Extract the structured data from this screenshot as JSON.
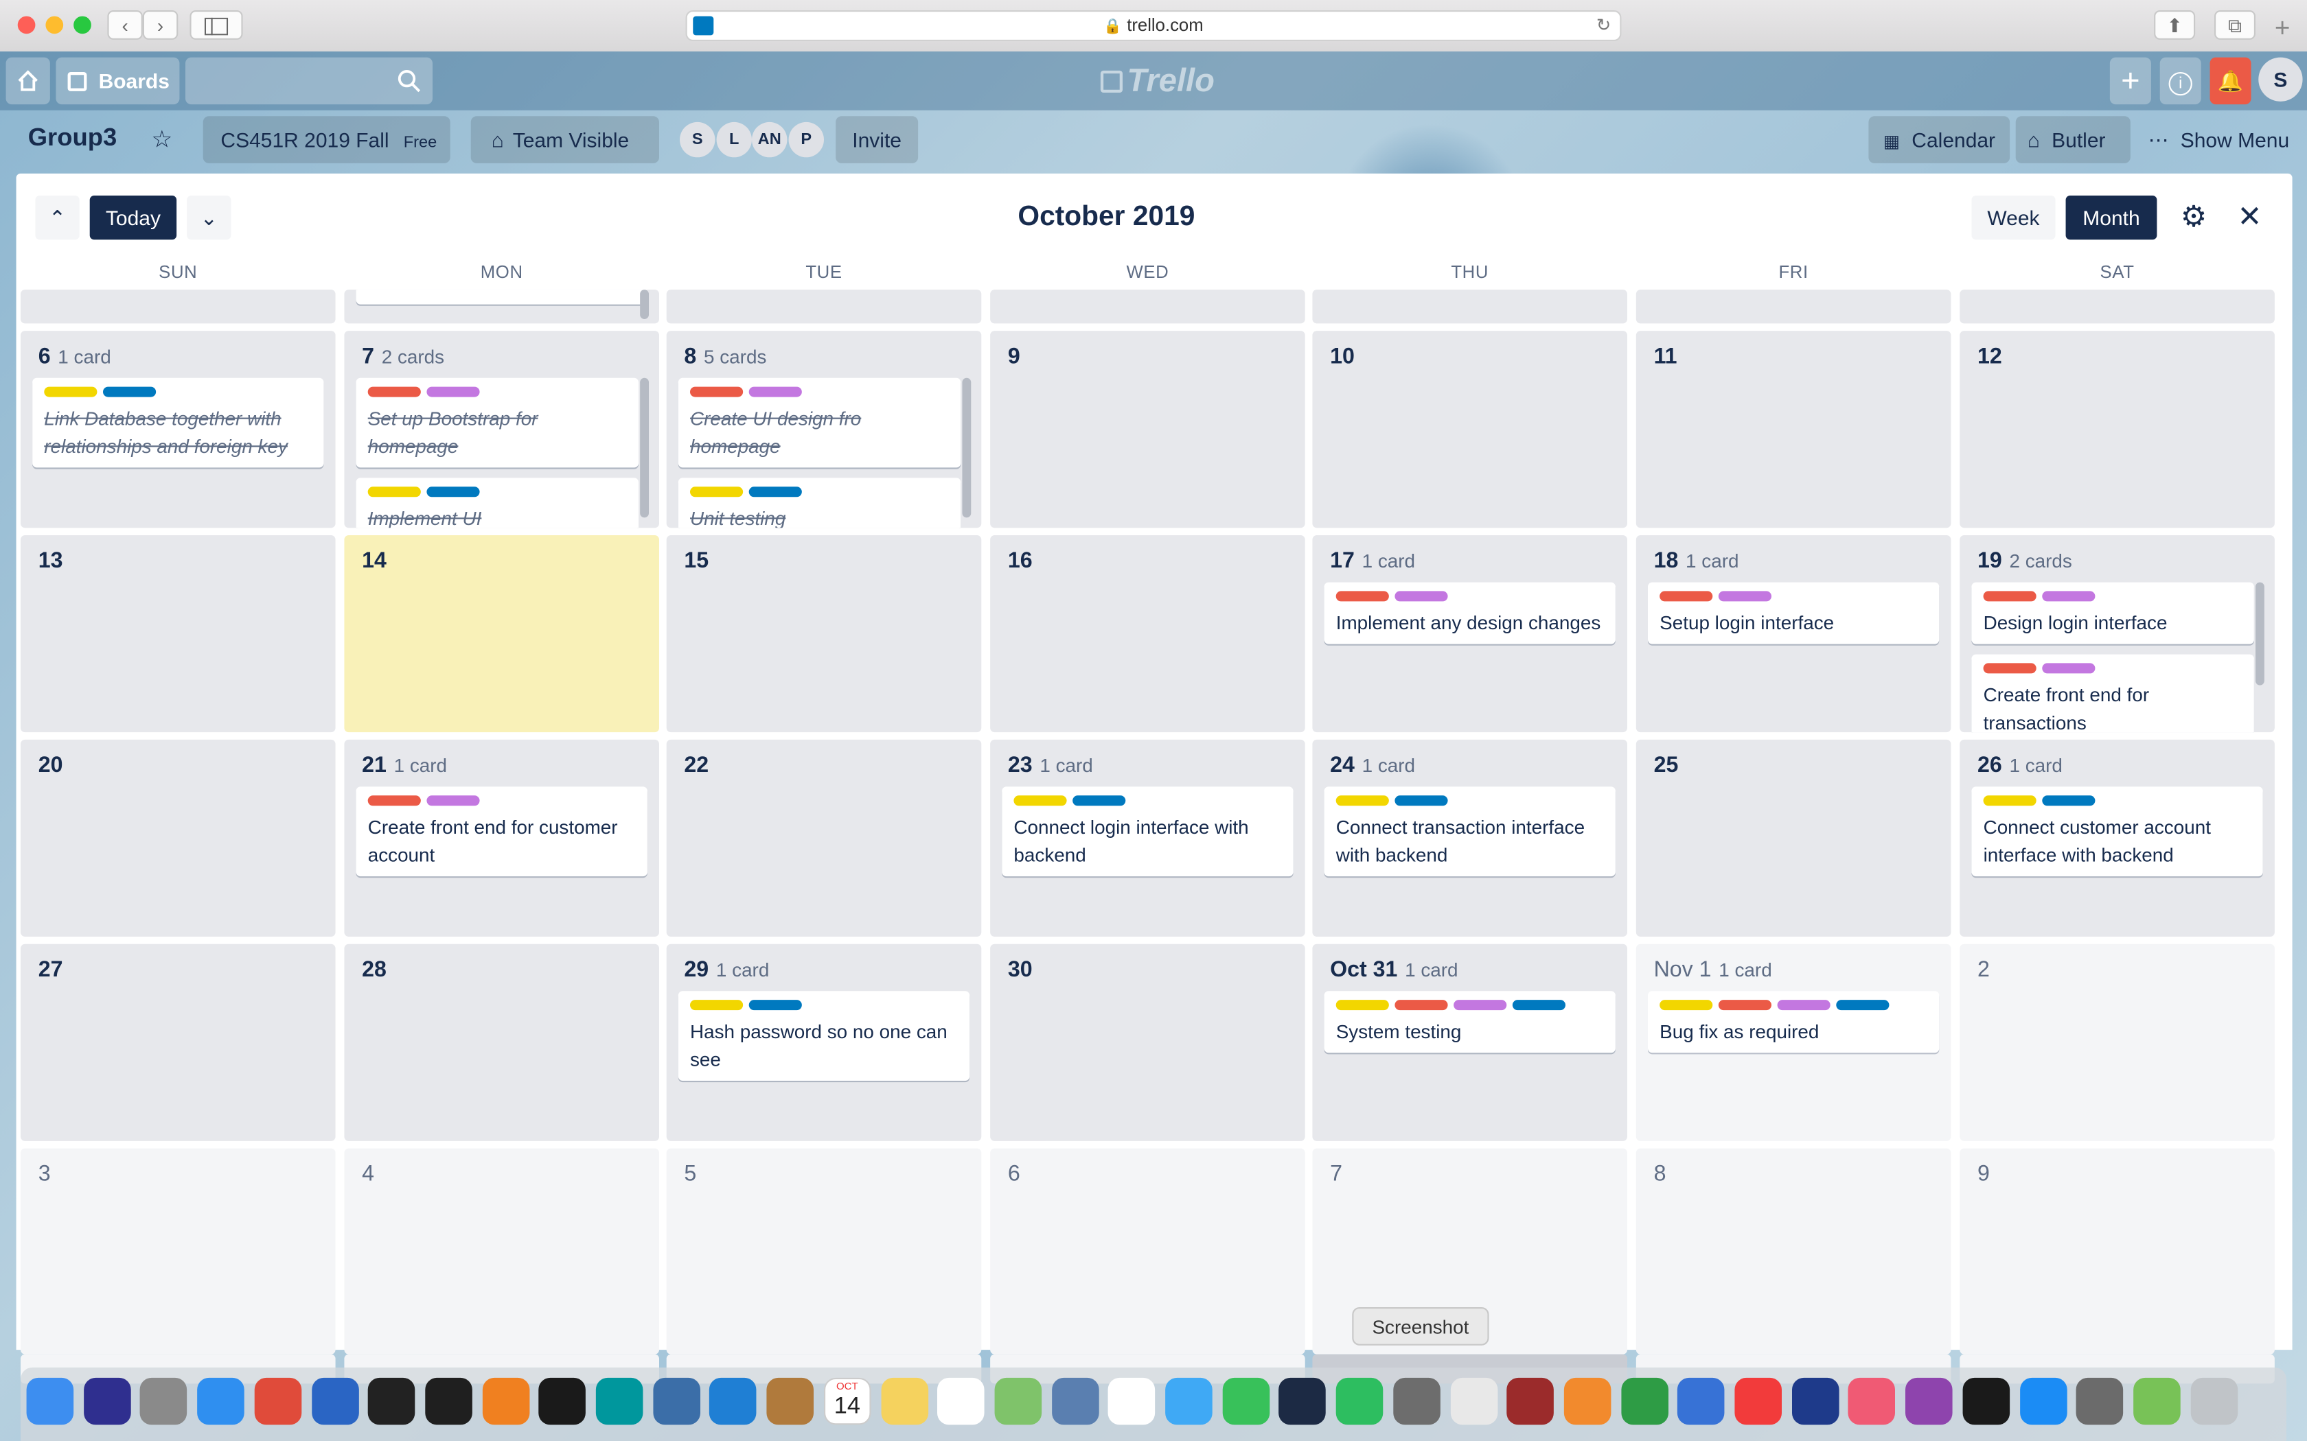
{
  "browser": {
    "url": "trello.com",
    "dock_tooltip": "Screenshot"
  },
  "header": {
    "boards_label": "Boards",
    "logo_text": "Trello",
    "user_initial": "S"
  },
  "board": {
    "name": "Group3",
    "team": "CS451R 2019 Fall",
    "team_badge": "Free",
    "visibility": "Team Visible",
    "members": [
      "S",
      "L",
      "AN",
      "P"
    ],
    "invite_label": "Invite",
    "calendar_label": "Calendar",
    "butler_label": "Butler",
    "show_menu_label": "Show Menu"
  },
  "calendar": {
    "title": "October 2019",
    "today_label": "Today",
    "week_label": "Week",
    "month_label": "Month",
    "weekdays": [
      "SUN",
      "MON",
      "TUE",
      "WED",
      "THU",
      "FRI",
      "SAT"
    ]
  },
  "colors": {
    "yellow": "#f2d600",
    "red": "#eb5a46",
    "purple": "#c377e0",
    "blue": "#0079bf",
    "today_bg": "#f9f1b8",
    "nav_dark": "#172b4d"
  },
  "weeks": [
    {
      "days": [
        {
          "num": "6",
          "count": "1 card",
          "cards": [
            {
              "labels": [
                "yellow",
                "blue"
              ],
              "text": "Link Database together with relationships and foreign key",
              "done": true
            }
          ]
        },
        {
          "num": "7",
          "count": "2 cards",
          "cards": [
            {
              "labels": [
                "red",
                "purple"
              ],
              "text": "Set up Bootstrap for homepage",
              "done": true
            },
            {
              "labels": [
                "yellow",
                "blue"
              ],
              "text": "Implement UI",
              "done": true
            }
          ]
        },
        {
          "num": "8",
          "count": "5 cards",
          "cards": [
            {
              "labels": [
                "red",
                "purple"
              ],
              "text": "Create UI design fro homepage",
              "done": true
            },
            {
              "labels": [
                "yellow",
                "blue"
              ],
              "text": "Unit testing",
              "done": true
            }
          ]
        },
        {
          "num": "9",
          "count": "",
          "cards": []
        },
        {
          "num": "10",
          "count": "",
          "cards": []
        },
        {
          "num": "11",
          "count": "",
          "cards": []
        },
        {
          "num": "12",
          "count": "",
          "cards": []
        }
      ]
    },
    {
      "days": [
        {
          "num": "13",
          "count": "",
          "cards": []
        },
        {
          "num": "14",
          "count": "",
          "cards": [],
          "today": true
        },
        {
          "num": "15",
          "count": "",
          "cards": []
        },
        {
          "num": "16",
          "count": "",
          "cards": []
        },
        {
          "num": "17",
          "count": "1 card",
          "cards": [
            {
              "labels": [
                "red",
                "purple"
              ],
              "text": "Implement any design changes"
            }
          ]
        },
        {
          "num": "18",
          "count": "1 card",
          "cards": [
            {
              "labels": [
                "red",
                "purple"
              ],
              "text": "Setup login interface"
            }
          ]
        },
        {
          "num": "19",
          "count": "2 cards",
          "cards": [
            {
              "labels": [
                "red",
                "purple"
              ],
              "text": "Design login interface"
            },
            {
              "labels": [
                "red",
                "purple"
              ],
              "text": "Create front end for transactions"
            }
          ]
        }
      ]
    },
    {
      "days": [
        {
          "num": "20",
          "count": "",
          "cards": []
        },
        {
          "num": "21",
          "count": "1 card",
          "cards": [
            {
              "labels": [
                "red",
                "purple"
              ],
              "text": "Create front end for customer account"
            }
          ]
        },
        {
          "num": "22",
          "count": "",
          "cards": []
        },
        {
          "num": "23",
          "count": "1 card",
          "cards": [
            {
              "labels": [
                "yellow",
                "blue"
              ],
              "text": "Connect login interface with backend"
            }
          ]
        },
        {
          "num": "24",
          "count": "1 card",
          "cards": [
            {
              "labels": [
                "yellow",
                "blue"
              ],
              "text": "Connect transaction interface with backend"
            }
          ]
        },
        {
          "num": "25",
          "count": "",
          "cards": []
        },
        {
          "num": "26",
          "count": "1 card",
          "cards": [
            {
              "labels": [
                "yellow",
                "blue"
              ],
              "text": "Connect customer account interface with backend"
            }
          ]
        }
      ]
    },
    {
      "days": [
        {
          "num": "27",
          "count": "",
          "cards": []
        },
        {
          "num": "28",
          "count": "",
          "cards": []
        },
        {
          "num": "29",
          "count": "1 card",
          "cards": [
            {
              "labels": [
                "yellow",
                "blue"
              ],
              "text": "Hash password so no one can see"
            }
          ]
        },
        {
          "num": "30",
          "count": "",
          "cards": []
        },
        {
          "num": "Oct 31",
          "count": "1 card",
          "cards": [
            {
              "labels": [
                "yellow",
                "red",
                "purple",
                "blue"
              ],
              "text": "System testing"
            }
          ]
        },
        {
          "num": "Nov 1",
          "count": "1 card",
          "other": true,
          "cards": [
            {
              "labels": [
                "yellow",
                "red",
                "purple",
                "blue"
              ],
              "text": "Bug fix as required"
            }
          ]
        },
        {
          "num": "2",
          "count": "",
          "cards": [],
          "other": true
        }
      ]
    },
    {
      "days": [
        {
          "num": "3",
          "count": "",
          "cards": [],
          "other": true
        },
        {
          "num": "4",
          "count": "",
          "cards": [],
          "other": true
        },
        {
          "num": "5",
          "count": "",
          "cards": [],
          "other": true
        },
        {
          "num": "6",
          "count": "",
          "cards": [],
          "other": true
        },
        {
          "num": "7",
          "count": "",
          "cards": [],
          "other": true
        },
        {
          "num": "8",
          "count": "",
          "cards": [],
          "other": true
        },
        {
          "num": "9",
          "count": "",
          "cards": [],
          "other": true
        }
      ]
    }
  ],
  "dock": {
    "calendar_month": "OCT",
    "calendar_day": "14",
    "apps": [
      "finder-icon",
      "siri-icon",
      "launchpad-icon",
      "safari-icon",
      "chrome-icon",
      "sourcetree-icon",
      "github-icon",
      "intellij-icon",
      "sublime-icon",
      "webstorm-icon",
      "arduino-icon",
      "python-icon",
      "vscode-icon",
      "contacts-icon",
      "calendar-icon",
      "notes-icon",
      "reminders-icon",
      "maps-icon",
      "preview-icon",
      "photos-icon",
      "messages-icon",
      "facetime-icon",
      "kindle-icon",
      "evernote-icon",
      "screenshot-icon",
      "textedit-icon",
      "dictionary-icon",
      "pages-icon",
      "numbers-icon",
      "keynote-icon",
      "news-icon",
      "quicktime-icon",
      "music-icon",
      "podcasts-icon",
      "tv-icon",
      "appstore-icon",
      "system-preferences-icon",
      "android-icon",
      "trash-icon"
    ]
  }
}
